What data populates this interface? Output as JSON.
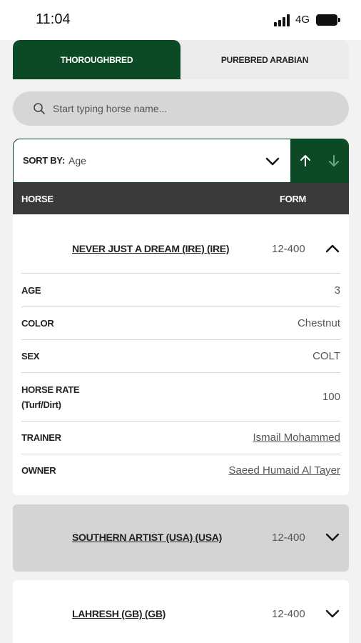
{
  "status": {
    "time": "11:04",
    "network": "4G"
  },
  "tabs": [
    {
      "label": "THOROUGHBRED",
      "active": true
    },
    {
      "label": "PUREBRED ARABIAN",
      "active": false
    }
  ],
  "search": {
    "placeholder": "Start typing horse name..."
  },
  "sort": {
    "label": "SORT BY:",
    "value": "Age"
  },
  "table": {
    "col_horse": "HORSE",
    "col_form": "FORM"
  },
  "horses": [
    {
      "name": "NEVER JUST A DREAM (IRE) (IRE)",
      "form": "12-400",
      "expanded": true,
      "details": [
        {
          "label": "AGE",
          "value": "3"
        },
        {
          "label": "COLOR",
          "value": "Chestnut"
        },
        {
          "label": "SEX",
          "value": "COLT"
        },
        {
          "label": "HORSE RATE\n(Turf/Dirt)",
          "value": "100"
        },
        {
          "label": "TRAINER",
          "value": "Ismail Mohammed"
        },
        {
          "label": "OWNER",
          "value": "Saeed Humaid Al Tayer"
        }
      ]
    },
    {
      "name": "SOUTHERN ARTIST (USA) (USA)",
      "form": "12-400",
      "expanded": false
    },
    {
      "name": "LAHRESH (GB) (GB)",
      "form": "12-400",
      "expanded": false
    }
  ],
  "colors": {
    "brand": "#0c4a25",
    "header": "#3a3a3a",
    "highlight_row": "#d4d4d4"
  }
}
